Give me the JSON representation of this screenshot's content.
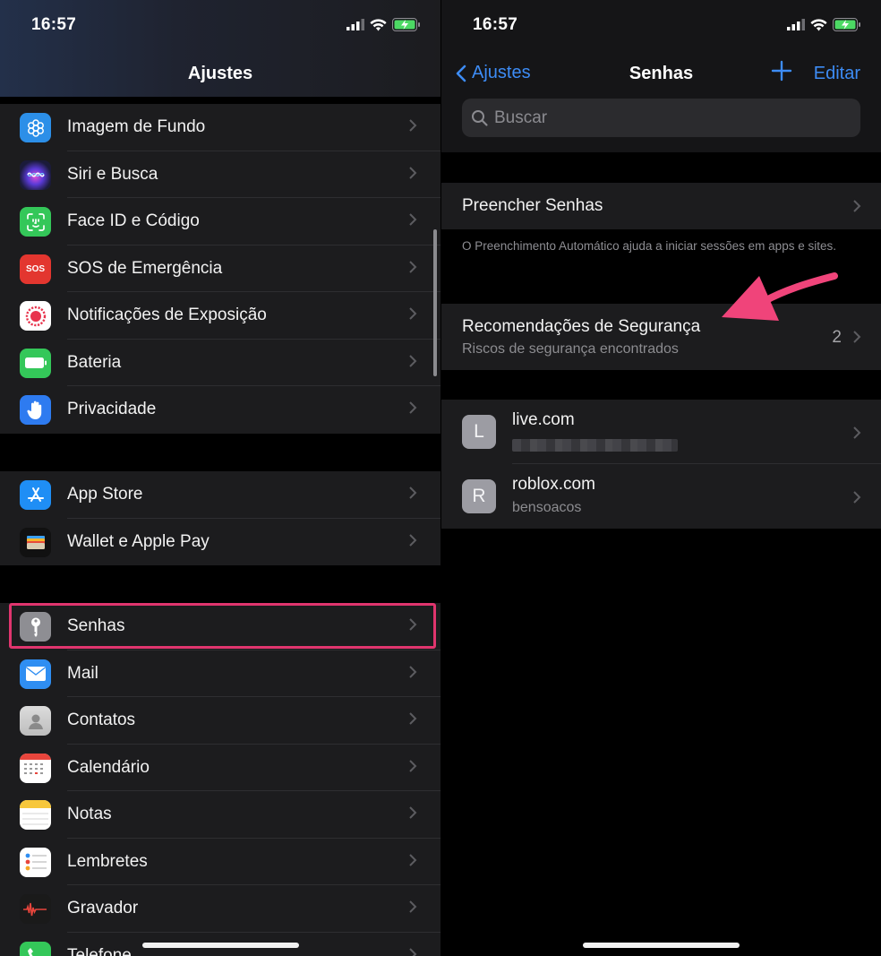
{
  "left": {
    "status": {
      "time": "16:57"
    },
    "title": "Ajustes",
    "group1": [
      {
        "label": "Imagem de Fundo",
        "icon": "wallpaper-icon"
      },
      {
        "label": "Siri e Busca",
        "icon": "siri-icon"
      },
      {
        "label": "Face ID e Código",
        "icon": "faceid-icon"
      },
      {
        "label": "SOS de Emergência",
        "icon": "sos-icon",
        "icon_text": "SOS"
      },
      {
        "label": "Notificações de Exposição",
        "icon": "exposure-icon"
      },
      {
        "label": "Bateria",
        "icon": "battery-icon"
      },
      {
        "label": "Privacidade",
        "icon": "privacy-hand-icon"
      }
    ],
    "group2": [
      {
        "label": "App Store",
        "icon": "app-store-icon"
      },
      {
        "label": "Wallet e Apple Pay",
        "icon": "wallet-icon"
      }
    ],
    "group3": [
      {
        "label": "Senhas",
        "icon": "key-icon"
      },
      {
        "label": "Mail",
        "icon": "mail-icon"
      },
      {
        "label": "Contatos",
        "icon": "contacts-icon"
      },
      {
        "label": "Calendário",
        "icon": "calendar-icon"
      },
      {
        "label": "Notas",
        "icon": "notes-icon"
      },
      {
        "label": "Lembretes",
        "icon": "reminders-icon"
      },
      {
        "label": "Gravador",
        "icon": "voice-memos-icon"
      },
      {
        "label": "Telefone",
        "icon": "phone-icon"
      }
    ]
  },
  "right": {
    "status": {
      "time": "16:57"
    },
    "back_label": "Ajustes",
    "title": "Senhas",
    "edit_label": "Editar",
    "search_placeholder": "Buscar",
    "autofill": {
      "title": "Preencher Senhas"
    },
    "autofill_footnote": "O Preenchimento Automático ajuda a iniciar sessões em apps e sites.",
    "security": {
      "title": "Recomendações de Segurança",
      "subtitle": "Riscos de segurança encontrados",
      "count": "2"
    },
    "passwords": [
      {
        "initial": "L",
        "site": "live.com",
        "user": ""
      },
      {
        "initial": "R",
        "site": "roblox.com",
        "user": "bensoacos"
      }
    ]
  },
  "colors": {
    "accent": "#3d8cf5",
    "highlight": "#e0356e",
    "arrow": "#f0447a",
    "cell": "#1c1c1e",
    "background": "#000000"
  }
}
